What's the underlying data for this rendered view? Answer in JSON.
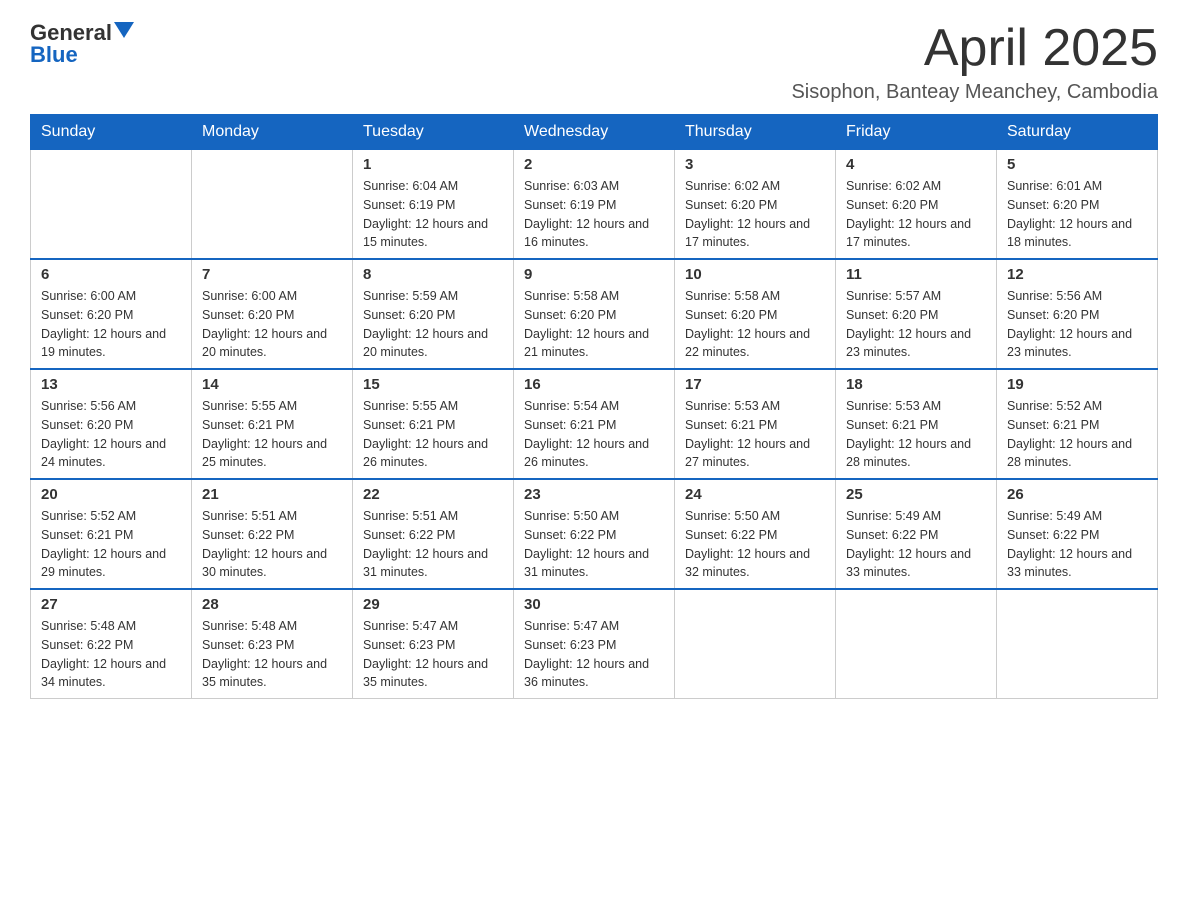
{
  "header": {
    "logo": {
      "general": "General",
      "blue": "Blue"
    },
    "title": "April 2025",
    "location": "Sisophon, Banteay Meanchey, Cambodia"
  },
  "weekdays": [
    "Sunday",
    "Monday",
    "Tuesday",
    "Wednesday",
    "Thursday",
    "Friday",
    "Saturday"
  ],
  "weeks": [
    [
      {
        "day": "",
        "sunrise": "",
        "sunset": "",
        "daylight": ""
      },
      {
        "day": "",
        "sunrise": "",
        "sunset": "",
        "daylight": ""
      },
      {
        "day": "1",
        "sunrise": "Sunrise: 6:04 AM",
        "sunset": "Sunset: 6:19 PM",
        "daylight": "Daylight: 12 hours and 15 minutes."
      },
      {
        "day": "2",
        "sunrise": "Sunrise: 6:03 AM",
        "sunset": "Sunset: 6:19 PM",
        "daylight": "Daylight: 12 hours and 16 minutes."
      },
      {
        "day": "3",
        "sunrise": "Sunrise: 6:02 AM",
        "sunset": "Sunset: 6:20 PM",
        "daylight": "Daylight: 12 hours and 17 minutes."
      },
      {
        "day": "4",
        "sunrise": "Sunrise: 6:02 AM",
        "sunset": "Sunset: 6:20 PM",
        "daylight": "Daylight: 12 hours and 17 minutes."
      },
      {
        "day": "5",
        "sunrise": "Sunrise: 6:01 AM",
        "sunset": "Sunset: 6:20 PM",
        "daylight": "Daylight: 12 hours and 18 minutes."
      }
    ],
    [
      {
        "day": "6",
        "sunrise": "Sunrise: 6:00 AM",
        "sunset": "Sunset: 6:20 PM",
        "daylight": "Daylight: 12 hours and 19 minutes."
      },
      {
        "day": "7",
        "sunrise": "Sunrise: 6:00 AM",
        "sunset": "Sunset: 6:20 PM",
        "daylight": "Daylight: 12 hours and 20 minutes."
      },
      {
        "day": "8",
        "sunrise": "Sunrise: 5:59 AM",
        "sunset": "Sunset: 6:20 PM",
        "daylight": "Daylight: 12 hours and 20 minutes."
      },
      {
        "day": "9",
        "sunrise": "Sunrise: 5:58 AM",
        "sunset": "Sunset: 6:20 PM",
        "daylight": "Daylight: 12 hours and 21 minutes."
      },
      {
        "day": "10",
        "sunrise": "Sunrise: 5:58 AM",
        "sunset": "Sunset: 6:20 PM",
        "daylight": "Daylight: 12 hours and 22 minutes."
      },
      {
        "day": "11",
        "sunrise": "Sunrise: 5:57 AM",
        "sunset": "Sunset: 6:20 PM",
        "daylight": "Daylight: 12 hours and 23 minutes."
      },
      {
        "day": "12",
        "sunrise": "Sunrise: 5:56 AM",
        "sunset": "Sunset: 6:20 PM",
        "daylight": "Daylight: 12 hours and 23 minutes."
      }
    ],
    [
      {
        "day": "13",
        "sunrise": "Sunrise: 5:56 AM",
        "sunset": "Sunset: 6:20 PM",
        "daylight": "Daylight: 12 hours and 24 minutes."
      },
      {
        "day": "14",
        "sunrise": "Sunrise: 5:55 AM",
        "sunset": "Sunset: 6:21 PM",
        "daylight": "Daylight: 12 hours and 25 minutes."
      },
      {
        "day": "15",
        "sunrise": "Sunrise: 5:55 AM",
        "sunset": "Sunset: 6:21 PM",
        "daylight": "Daylight: 12 hours and 26 minutes."
      },
      {
        "day": "16",
        "sunrise": "Sunrise: 5:54 AM",
        "sunset": "Sunset: 6:21 PM",
        "daylight": "Daylight: 12 hours and 26 minutes."
      },
      {
        "day": "17",
        "sunrise": "Sunrise: 5:53 AM",
        "sunset": "Sunset: 6:21 PM",
        "daylight": "Daylight: 12 hours and 27 minutes."
      },
      {
        "day": "18",
        "sunrise": "Sunrise: 5:53 AM",
        "sunset": "Sunset: 6:21 PM",
        "daylight": "Daylight: 12 hours and 28 minutes."
      },
      {
        "day": "19",
        "sunrise": "Sunrise: 5:52 AM",
        "sunset": "Sunset: 6:21 PM",
        "daylight": "Daylight: 12 hours and 28 minutes."
      }
    ],
    [
      {
        "day": "20",
        "sunrise": "Sunrise: 5:52 AM",
        "sunset": "Sunset: 6:21 PM",
        "daylight": "Daylight: 12 hours and 29 minutes."
      },
      {
        "day": "21",
        "sunrise": "Sunrise: 5:51 AM",
        "sunset": "Sunset: 6:22 PM",
        "daylight": "Daylight: 12 hours and 30 minutes."
      },
      {
        "day": "22",
        "sunrise": "Sunrise: 5:51 AM",
        "sunset": "Sunset: 6:22 PM",
        "daylight": "Daylight: 12 hours and 31 minutes."
      },
      {
        "day": "23",
        "sunrise": "Sunrise: 5:50 AM",
        "sunset": "Sunset: 6:22 PM",
        "daylight": "Daylight: 12 hours and 31 minutes."
      },
      {
        "day": "24",
        "sunrise": "Sunrise: 5:50 AM",
        "sunset": "Sunset: 6:22 PM",
        "daylight": "Daylight: 12 hours and 32 minutes."
      },
      {
        "day": "25",
        "sunrise": "Sunrise: 5:49 AM",
        "sunset": "Sunset: 6:22 PM",
        "daylight": "Daylight: 12 hours and 33 minutes."
      },
      {
        "day": "26",
        "sunrise": "Sunrise: 5:49 AM",
        "sunset": "Sunset: 6:22 PM",
        "daylight": "Daylight: 12 hours and 33 minutes."
      }
    ],
    [
      {
        "day": "27",
        "sunrise": "Sunrise: 5:48 AM",
        "sunset": "Sunset: 6:22 PM",
        "daylight": "Daylight: 12 hours and 34 minutes."
      },
      {
        "day": "28",
        "sunrise": "Sunrise: 5:48 AM",
        "sunset": "Sunset: 6:23 PM",
        "daylight": "Daylight: 12 hours and 35 minutes."
      },
      {
        "day": "29",
        "sunrise": "Sunrise: 5:47 AM",
        "sunset": "Sunset: 6:23 PM",
        "daylight": "Daylight: 12 hours and 35 minutes."
      },
      {
        "day": "30",
        "sunrise": "Sunrise: 5:47 AM",
        "sunset": "Sunset: 6:23 PM",
        "daylight": "Daylight: 12 hours and 36 minutes."
      },
      {
        "day": "",
        "sunrise": "",
        "sunset": "",
        "daylight": ""
      },
      {
        "day": "",
        "sunrise": "",
        "sunset": "",
        "daylight": ""
      },
      {
        "day": "",
        "sunrise": "",
        "sunset": "",
        "daylight": ""
      }
    ]
  ],
  "colors": {
    "header_bg": "#1565c0",
    "header_text": "#ffffff",
    "border": "#cccccc",
    "row_border_bottom": "#1565c0"
  }
}
